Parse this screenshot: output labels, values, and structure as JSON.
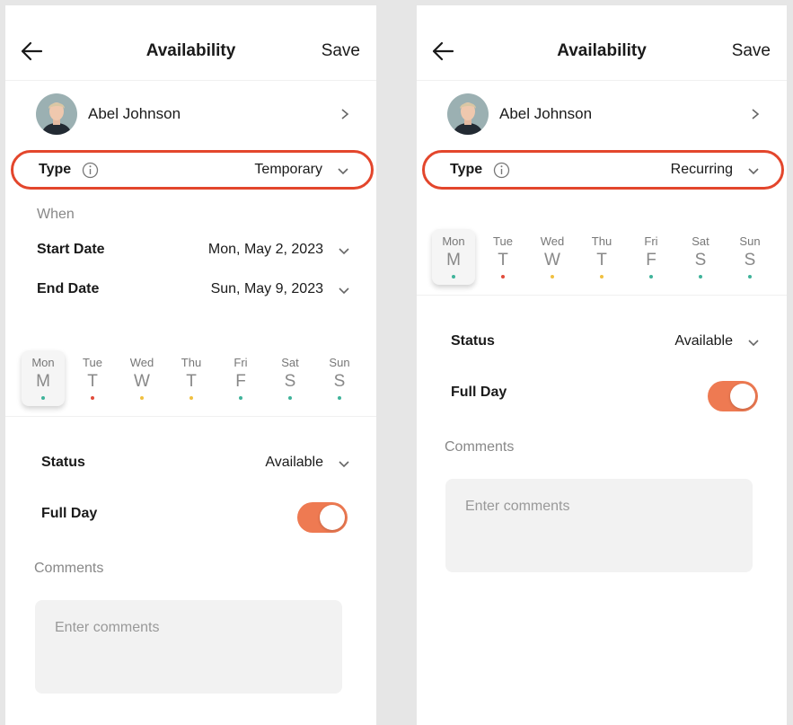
{
  "colors": {
    "accent": "#ee7a52",
    "highlight": "#e3462c",
    "dot_teal": "#3fb39a",
    "dot_red": "#e14b3b",
    "dot_yellow": "#f0c040"
  },
  "left": {
    "header": {
      "title": "Availability",
      "save_label": "Save",
      "back_icon": "arrow-left-icon"
    },
    "user": {
      "name": "Abel Johnson"
    },
    "type": {
      "label": "Type",
      "value": "Temporary"
    },
    "when": {
      "label": "When",
      "start": {
        "label": "Start Date",
        "value": "Mon, May 2, 2023"
      },
      "end": {
        "label": "End Date",
        "value": "Sun, May 9, 2023"
      }
    },
    "days": [
      {
        "name": "Mon",
        "letter": "M",
        "dot": "teal",
        "selected": true
      },
      {
        "name": "Tue",
        "letter": "T",
        "dot": "red",
        "selected": false
      },
      {
        "name": "Wed",
        "letter": "W",
        "dot": "yellow",
        "selected": false
      },
      {
        "name": "Thu",
        "letter": "T",
        "dot": "yellow",
        "selected": false
      },
      {
        "name": "Fri",
        "letter": "F",
        "dot": "teal",
        "selected": false
      },
      {
        "name": "Sat",
        "letter": "S",
        "dot": "teal",
        "selected": false
      },
      {
        "name": "Sun",
        "letter": "S",
        "dot": "teal",
        "selected": false
      }
    ],
    "status": {
      "label": "Status",
      "value": "Available"
    },
    "full_day": {
      "label": "Full Day",
      "on": true
    },
    "comments": {
      "label": "Comments",
      "placeholder": "Enter comments"
    }
  },
  "right": {
    "header": {
      "title": "Availability",
      "save_label": "Save",
      "back_icon": "arrow-left-icon"
    },
    "user": {
      "name": "Abel Johnson"
    },
    "type": {
      "label": "Type",
      "value": "Recurring"
    },
    "days": [
      {
        "name": "Mon",
        "letter": "M",
        "dot": "teal",
        "selected": true
      },
      {
        "name": "Tue",
        "letter": "T",
        "dot": "red",
        "selected": false
      },
      {
        "name": "Wed",
        "letter": "W",
        "dot": "yellow",
        "selected": false
      },
      {
        "name": "Thu",
        "letter": "T",
        "dot": "yellow",
        "selected": false
      },
      {
        "name": "Fri",
        "letter": "F",
        "dot": "teal",
        "selected": false
      },
      {
        "name": "Sat",
        "letter": "S",
        "dot": "teal",
        "selected": false
      },
      {
        "name": "Sun",
        "letter": "S",
        "dot": "teal",
        "selected": false
      }
    ],
    "status": {
      "label": "Status",
      "value": "Available"
    },
    "full_day": {
      "label": "Full Day",
      "on": true
    },
    "comments": {
      "label": "Comments",
      "placeholder": "Enter comments"
    }
  }
}
